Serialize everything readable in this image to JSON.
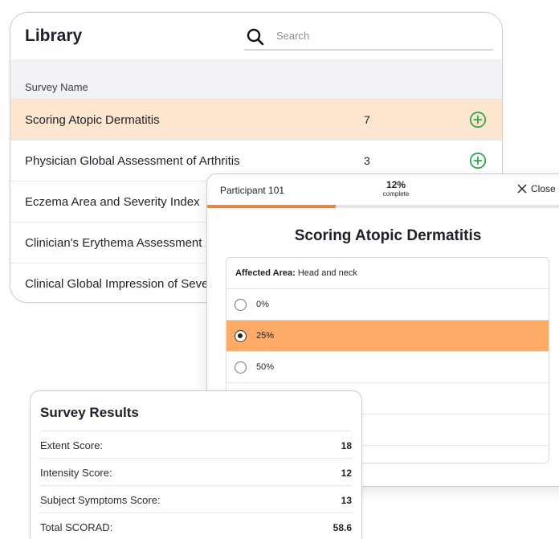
{
  "library": {
    "title": "Library",
    "search": {
      "placeholder": "Search",
      "value": ""
    },
    "column_header": "Survey Name",
    "rows": [
      {
        "name": "Scoring Atopic Dermatitis",
        "count": "7"
      },
      {
        "name": "Physician Global Assessment of Arthritis",
        "count": "3"
      },
      {
        "name": "Eczema Area and Severity Index",
        "count": ""
      },
      {
        "name": "Clinician's Erythema Assessment",
        "count": ""
      },
      {
        "name": "Clinical Global Impression of Severity",
        "count": ""
      }
    ]
  },
  "survey_modal": {
    "participant": "Participant 101",
    "progress_percent": "12%",
    "progress_label": "complete",
    "progress_fraction": 0.35,
    "close_label": "Close",
    "title": "Scoring Atopic Dermatitis",
    "question": {
      "label": "Affected Area:",
      "value": "Head and neck"
    },
    "options": [
      {
        "label": "0%",
        "selected": false
      },
      {
        "label": "25%",
        "selected": true
      },
      {
        "label": "50%",
        "selected": false
      },
      {
        "label": "",
        "selected": false
      },
      {
        "label": "",
        "selected": false
      }
    ]
  },
  "results": {
    "title": "Survey Results",
    "rows": [
      {
        "label": "Extent Score:",
        "value": "18"
      },
      {
        "label": "Intensity Score:",
        "value": "12"
      },
      {
        "label": "Subject Symptoms Score:",
        "value": "13"
      },
      {
        "label": "Total SCORAD:",
        "value": "58.6"
      }
    ]
  },
  "colors": {
    "accent_orange": "#f0843c",
    "selected_option": "#fdab66",
    "highlight_row": "#fde6cf",
    "add_icon_green": "#2fa84f"
  },
  "icons": {
    "search": "search-icon",
    "add": "plus-circle-icon",
    "close": "close-icon"
  }
}
